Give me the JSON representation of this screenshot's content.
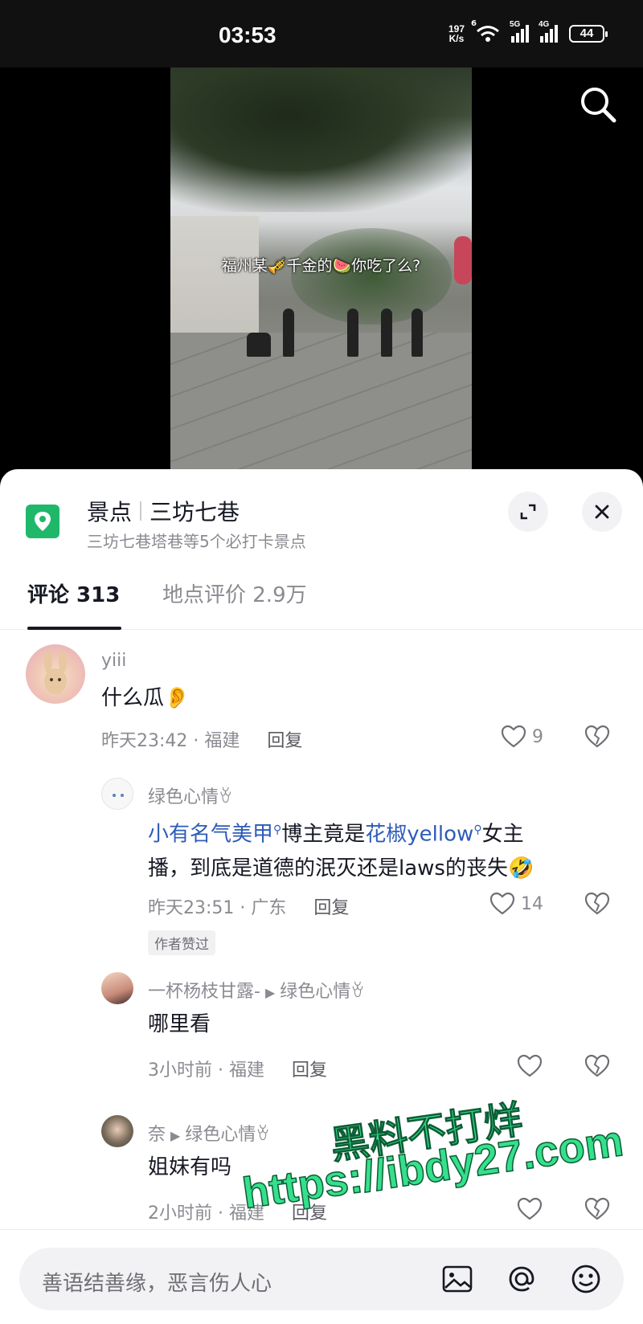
{
  "status_bar": {
    "time": "03:53",
    "net_speed_value": "197",
    "net_speed_unit": "K/s",
    "sim1_tag": "5G",
    "sim2_tag": "4G",
    "wifi_tag": "6",
    "battery": "44"
  },
  "video": {
    "caption": "福州某🎺千金的🍉你吃了么?"
  },
  "place": {
    "category": "景点",
    "name": "三坊七巷",
    "subtitle": "三坊七巷塔巷等5个必打卡景点"
  },
  "tabs": {
    "comments": "评论 313",
    "reviews": "地点评价 2.9万"
  },
  "comments": [
    {
      "name": "yiii",
      "text": "什么瓜👂",
      "time_loc": "昨天23:42 · 福建",
      "reply": "回复",
      "likes": "9"
    },
    {
      "name": "绿色心情ꈊ",
      "link1": "小有名气美甲",
      "text1": "博主竟是",
      "link2": "花椒yellow",
      "text2": "女主",
      "text3": "播，到底是道德的泯灭还是laws的丧失🤣",
      "time_loc": "昨天23:51 · 广东",
      "reply": "回复",
      "likes": "14",
      "badge": "作者赞过"
    },
    {
      "name": "一杯杨枝甘露-",
      "reply_to": "绿色心情ꈊ",
      "text": "哪里看",
      "time_loc": "3小时前 · 福建",
      "reply": "回复"
    },
    {
      "name": "奈",
      "reply_to": "绿色心情ꈊ",
      "text": "姐妹有吗",
      "time_loc": "2小时前 · 福建",
      "reply": "回复"
    }
  ],
  "watermark": {
    "line1": "黑料不打烊",
    "line2": "https://ibdy27.com"
  },
  "input": {
    "placeholder": "善语结善缘，恶言伤人心"
  }
}
